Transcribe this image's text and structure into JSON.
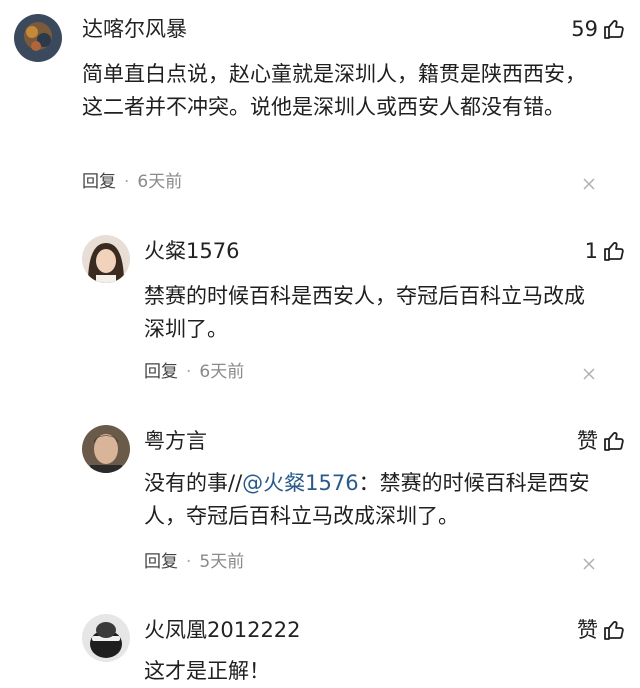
{
  "comments": [
    {
      "user": "达喀尔风暴",
      "likes": "59",
      "text": "简单直白点说，赵心童就是深圳人，籍贯是陕西西安，这二者并不冲突。说他是深圳人或西安人都没有错。",
      "reply_label": "回复",
      "time": "6天前"
    },
    {
      "user": "火粲1576",
      "likes": "1",
      "text": "禁赛的时候百科是西安人，夺冠后百科立马改成深圳了。",
      "reply_label": "回复",
      "time": "6天前"
    },
    {
      "user": "粤方言",
      "likes": "赞",
      "text_prefix": "没有的事//",
      "mention": "@火粲1576",
      "text_suffix": "：禁赛的时候百科是西安人，夺冠后百科立马改成深圳了。",
      "reply_label": "回复",
      "time": "5天前"
    },
    {
      "user": "火凤凰2012222",
      "likes": "赞",
      "text": "这才是正解！"
    }
  ],
  "separator": "·",
  "icons": {
    "like": "thumbs-up-icon",
    "close": "close-icon"
  },
  "colors": {
    "mention": "#2a5a8a",
    "meta": "#8a8a8a"
  }
}
